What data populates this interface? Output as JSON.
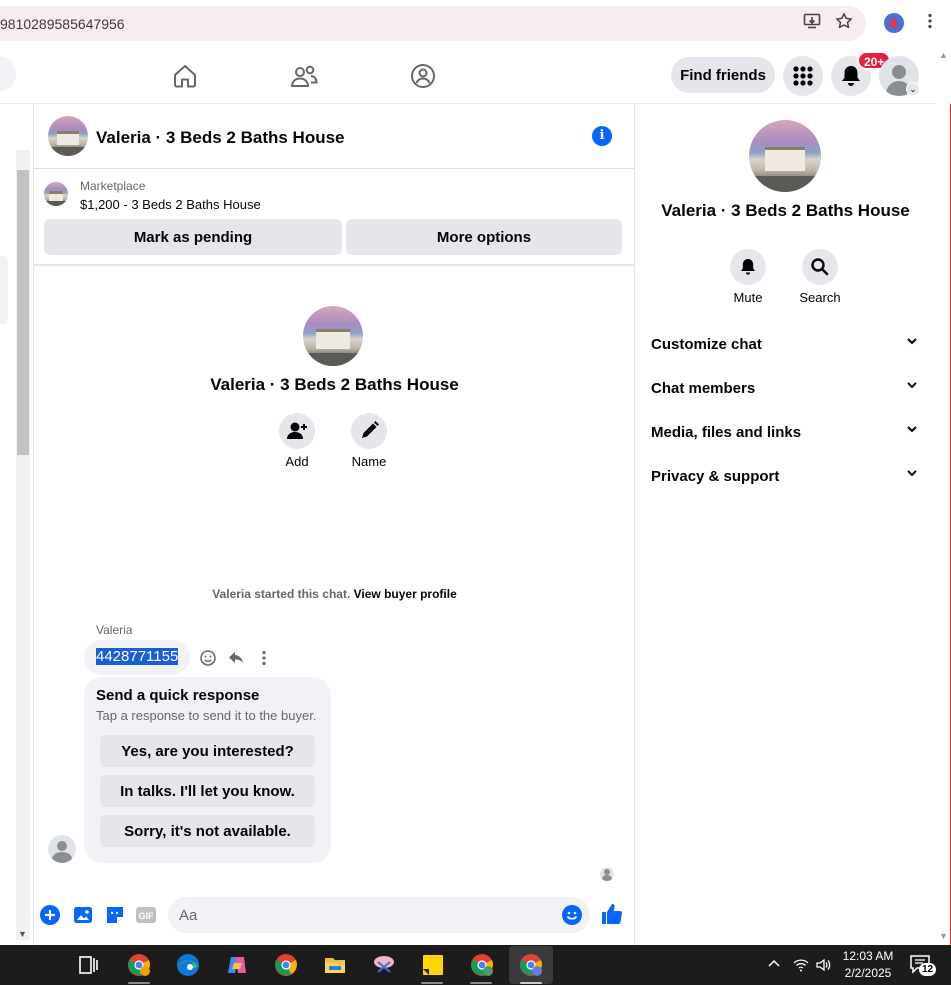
{
  "browser": {
    "url_fragment": "9810289585647956"
  },
  "fbnav": {
    "find_friends": "Find friends",
    "notification_badge": "20+"
  },
  "chat": {
    "title": "Valeria · 3 Beds 2 Baths House",
    "marketplace_label": "Marketplace",
    "listing": "$1,200 - 3 Beds 2 Baths House",
    "mark_pending": "Mark as pending",
    "more_options": "More options",
    "intro_title": "Valeria · 3 Beds 2 Baths House",
    "add_label": "Add",
    "name_label": "Name",
    "started_text": "Valeria started this chat.",
    "view_buyer": "View buyer profile",
    "sender": "Valeria",
    "message": "4428771155",
    "quick_title": "Send a quick response",
    "quick_sub": "Tap a response to send it to the buyer.",
    "quick_responses": [
      "Yes, are you interested?",
      "In talks. I'll let you know.",
      "Sorry, it's not available."
    ],
    "composer_placeholder": "Aa"
  },
  "right_panel": {
    "title": "Valeria · 3 Beds 2 Baths House",
    "mute": "Mute",
    "search": "Search",
    "sections": [
      "Customize chat",
      "Chat members",
      "Media, files and links",
      "Privacy & support"
    ]
  },
  "taskbar": {
    "time": "12:03 AM",
    "date": "2/2/2025",
    "notif_count": "12"
  },
  "colors": {
    "accent": "#0866ff",
    "badge": "#e41e3f",
    "selection": "#1a5fd6"
  }
}
